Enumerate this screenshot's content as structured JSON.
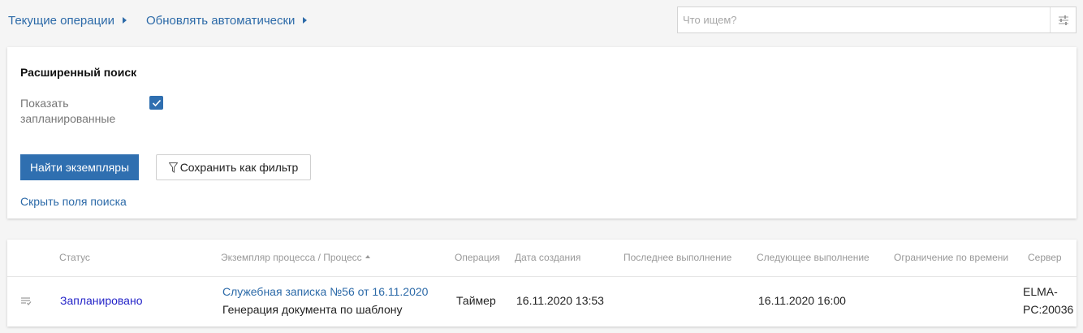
{
  "breadcrumb": {
    "items": [
      {
        "label": "Текущие операции"
      },
      {
        "label": "Обновлять автоматически"
      }
    ]
  },
  "search": {
    "placeholder": "Что ищем?",
    "settings_icon": "sliders-icon"
  },
  "advanced_search": {
    "title": "Расширенный поиск",
    "show_scheduled_label": "Показать запланированные",
    "show_scheduled_checked": true,
    "find_button": "Найти экземпляры",
    "save_filter_button": "Сохранить как фильтр",
    "hide_fields_link": "Скрыть поля поиска"
  },
  "table": {
    "columns": [
      "Статус",
      "Экземпляр процесса / Процесс",
      "Операция",
      "Дата создания",
      "Последнее выполнение",
      "Следующее выполнение",
      "Ограничение по времени",
      "Сервер"
    ],
    "sorted_column": "Экземпляр процесса / Процесс",
    "rows": [
      {
        "status": "Запланировано",
        "instance": "Служебная записка №56 от 16.11.2020",
        "process": "Генерация документа по шаблону",
        "operation": "Таймер",
        "created": "16.11.2020 13:53",
        "last_run": "",
        "next_run": "16.11.2020 16:00",
        "time_limit": "",
        "server_line1": "ELMA-",
        "server_line2": "PC:20036"
      }
    ]
  },
  "colors": {
    "link": "#2c6aa8",
    "primary_button": "#2f6fb0",
    "status_link": "#2424c8",
    "background": "#f5f5f5"
  }
}
